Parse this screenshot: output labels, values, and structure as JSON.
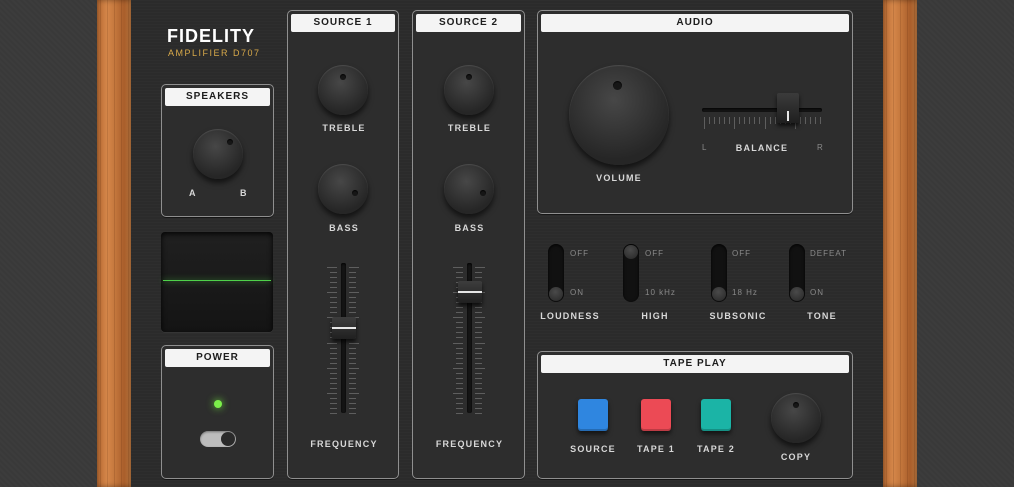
{
  "brand": {
    "title": "FIDELITY",
    "subtitle": "AMPLIFIER D707"
  },
  "speakers": {
    "title": "SPEAKERS",
    "label_a": "A",
    "label_b": "B"
  },
  "power": {
    "title": "POWER",
    "on": true
  },
  "source1": {
    "title": "SOURCE 1",
    "treble": "TREBLE",
    "bass": "BASS",
    "frequency": "FREQUENCY"
  },
  "source2": {
    "title": "SOURCE 2",
    "treble": "TREBLE",
    "bass": "BASS",
    "frequency": "FREQUENCY"
  },
  "audio": {
    "title": "AUDIO",
    "volume": "VOLUME",
    "balance": "BALANCE",
    "left": "L",
    "right": "R"
  },
  "switches": [
    {
      "name": "LOUDNESS",
      "top": "OFF",
      "bottom": "ON",
      "state": "bottom"
    },
    {
      "name": "HIGH",
      "top": "OFF",
      "bottom": "10 kHz",
      "state": "top"
    },
    {
      "name": "SUBSONIC",
      "top": "OFF",
      "bottom": "18 Hz",
      "state": "bottom"
    },
    {
      "name": "TONE",
      "top": "DEFEAT",
      "bottom": "ON",
      "state": "bottom"
    }
  ],
  "tape_play": {
    "title": "TAPE PLAY",
    "buttons": [
      {
        "label": "SOURCE",
        "color": "#2f86e0"
      },
      {
        "label": "TAPE 1",
        "color": "#ec4a55"
      },
      {
        "label": "TAPE 2",
        "color": "#1bb4a6"
      }
    ],
    "copy": "COPY"
  }
}
